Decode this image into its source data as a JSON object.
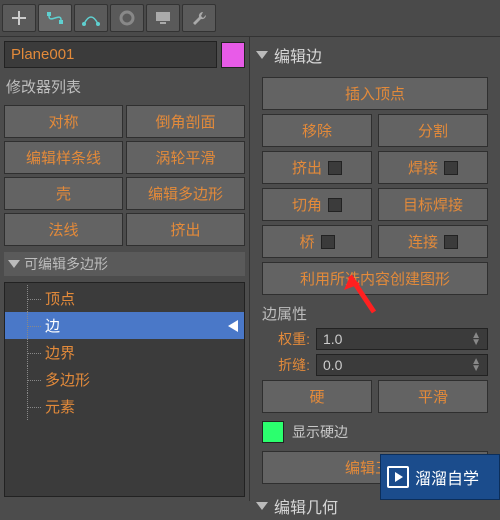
{
  "topbar": {
    "icons": [
      "plus",
      "bezier",
      "arc",
      "circle",
      "monitor",
      "wrench"
    ]
  },
  "object": {
    "name": "Plane001",
    "color": "#e85be8"
  },
  "modifier_list_label": "修改器列表",
  "left_buttons": [
    [
      "对称",
      "倒角剖面"
    ],
    [
      "编辑样条线",
      "涡轮平滑"
    ],
    [
      "壳",
      "编辑多边形"
    ],
    [
      "法线",
      "挤出"
    ]
  ],
  "stack": {
    "title": "可编辑多边形",
    "items": [
      "顶点",
      "边",
      "边界",
      "多边形",
      "元素"
    ],
    "selected_index": 1
  },
  "edit_edges": {
    "title": "编辑边",
    "insert_vertex": "插入顶点",
    "row1": [
      "移除",
      "分割"
    ],
    "row2": [
      "挤出",
      "焊接"
    ],
    "row3": [
      "切角",
      "目标焊接"
    ],
    "row4": [
      "桥",
      "连接"
    ],
    "create_shape": "利用所选内容创建图形",
    "edge_props_label": "边属性",
    "weight_label": "权重:",
    "weight_value": "1.0",
    "crease_label": "折缝:",
    "crease_value": "0.0",
    "hard": "硬",
    "smooth": "平滑",
    "display_hard": "显示硬边",
    "edit_tri": "编辑三角"
  },
  "edit_geom_title": "编辑几何",
  "watermark": "溜溜自学"
}
